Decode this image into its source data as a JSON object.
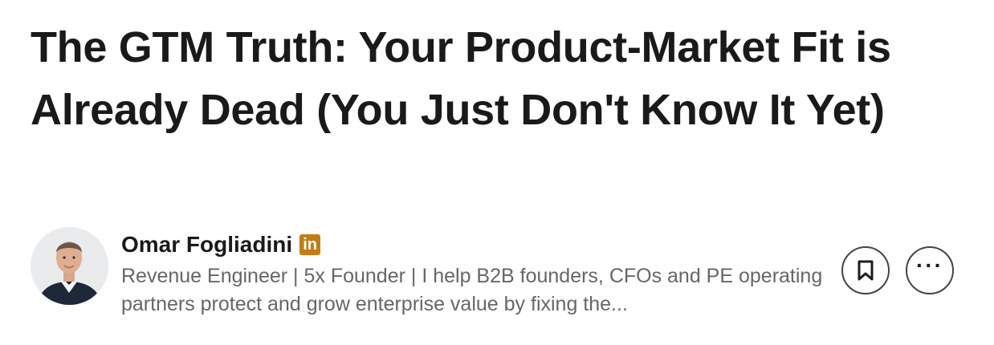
{
  "article": {
    "title": "The GTM Truth: Your Product-Market Fit is Already Dead (You Just Don't Know It Yet)"
  },
  "author": {
    "name": "Omar Fogliadini",
    "badge_text": "in",
    "headline": "Revenue Engineer | 5x Founder | I help B2B founders, CFOs and PE operating partners protect and grow enterprise value by fixing the...",
    "avatar_icon": "person-photo",
    "badge_icon": "linkedin-icon"
  },
  "actions": {
    "save_icon": "bookmark-icon",
    "more_label": "···"
  },
  "colors": {
    "title": "#1a1a1a",
    "headline": "#666666",
    "badge": "#c37d16",
    "button_border": "#444444"
  }
}
